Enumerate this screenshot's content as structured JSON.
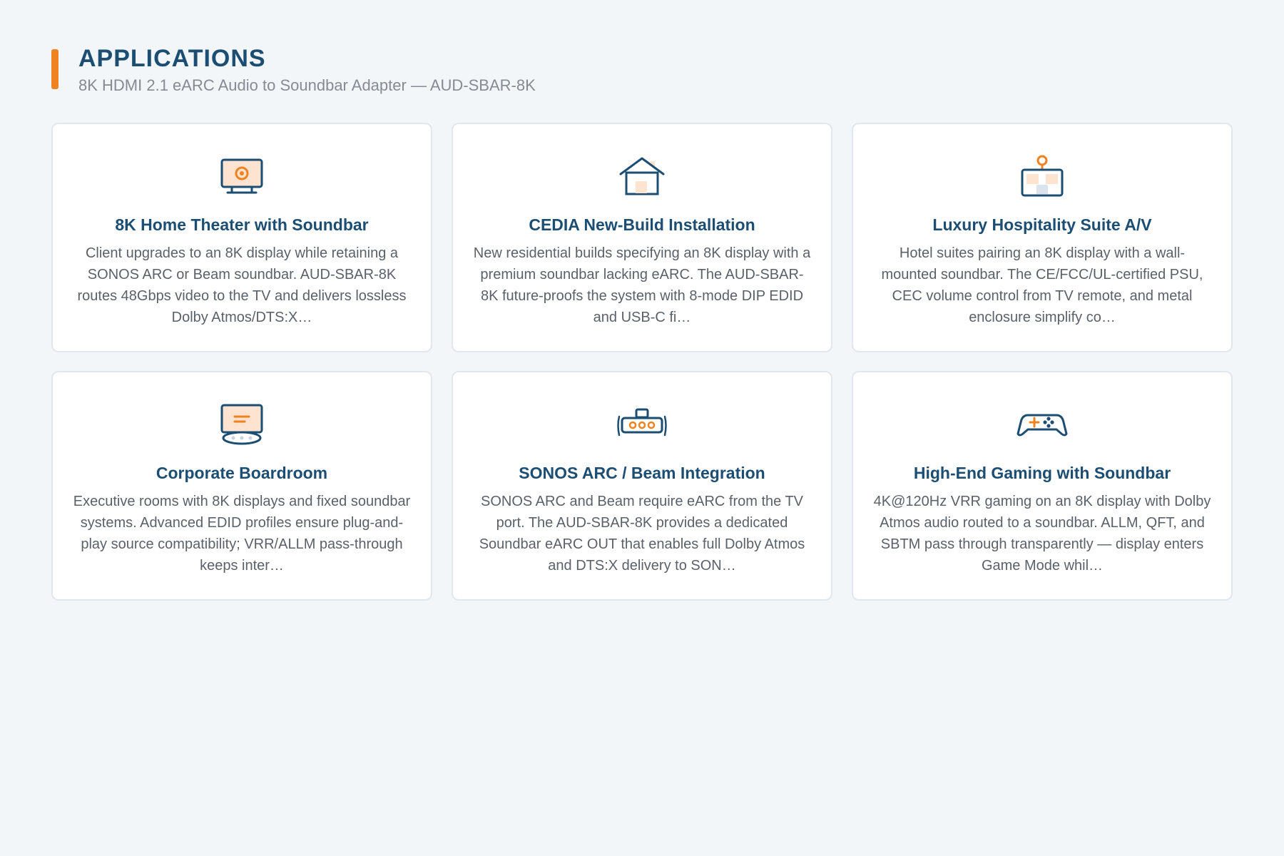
{
  "header": {
    "title": "APPLICATIONS",
    "subtitle": "8K HDMI 2.1 eARC Audio to Soundbar Adapter — AUD-SBAR-8K"
  },
  "colors": {
    "accent": "#f08321",
    "heading": "#1c4d72",
    "body_text": "#5b6168",
    "background": "#f3f6f9"
  },
  "cards": [
    {
      "icon": "tv-display-icon",
      "title": "8K Home Theater with Soundbar",
      "description": "Client upgrades to an 8K display while retaining a SONOS ARC or Beam soundbar. AUD-SBAR-8K routes 48Gbps video to the TV and delivers lossless Dolby Atmos/DTS:X…"
    },
    {
      "icon": "house-icon",
      "title": "CEDIA New-Build Installation",
      "description": "New residential builds specifying an 8K display with a premium soundbar lacking eARC. The AUD-SBAR-8K future-proofs the system with 8-mode DIP EDID and USB-C fi…"
    },
    {
      "icon": "hotel-suite-icon",
      "title": "Luxury Hospitality Suite A/V",
      "description": "Hotel suites pairing an 8K display with a wall-mounted soundbar. The CE/FCC/UL-certified PSU, CEC volume control from TV remote, and metal enclosure simplify co…"
    },
    {
      "icon": "boardroom-icon",
      "title": "Corporate Boardroom",
      "description": "Executive rooms with 8K displays and fixed soundbar systems. Advanced EDID profiles ensure plug-and-play source compatibility; VRR/ALLM pass-through keeps inter…"
    },
    {
      "icon": "soundbar-icon",
      "title": "SONOS ARC / Beam Integration",
      "description": "SONOS ARC and Beam require eARC from the TV port. The AUD-SBAR-8K provides a dedicated Soundbar eARC OUT that enables full Dolby Atmos and DTS:X delivery to SON…"
    },
    {
      "icon": "gamepad-icon",
      "title": "High-End Gaming with Soundbar",
      "description": "4K@120Hz VRR gaming on an 8K display with Dolby Atmos audio routed to a soundbar. ALLM, QFT, and SBTM pass through transparently — display enters Game Mode whil…"
    }
  ]
}
